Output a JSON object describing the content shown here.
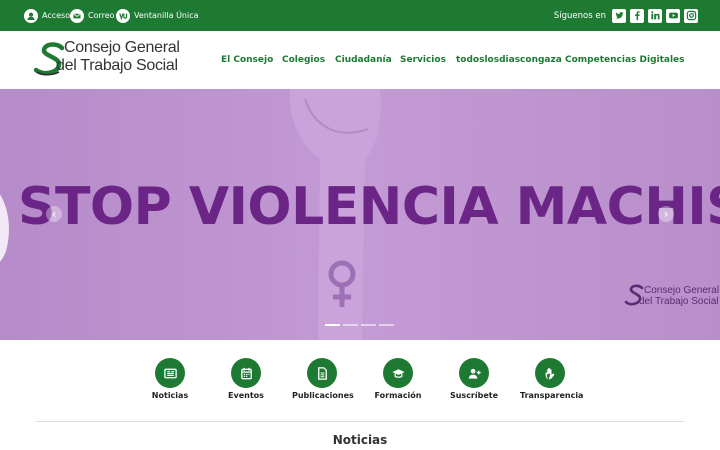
{
  "topbar": {
    "links": [
      {
        "label": "Acceso",
        "icon": "user-icon"
      },
      {
        "label": "Correo",
        "icon": "mail-icon"
      },
      {
        "label": "Ventanilla Única",
        "icon": "vu-icon"
      }
    ],
    "follow_label": "Síguenos en",
    "social": [
      "twitter-icon",
      "facebook-icon",
      "linkedin-icon",
      "youtube-icon",
      "instagram-icon"
    ]
  },
  "header": {
    "logo_line1": "Consejo General",
    "logo_line2": "del Trabajo Social",
    "nav": [
      "El Consejo",
      "Colegios",
      "Ciudadanía",
      "Servicios",
      "todoslosdiascongaza",
      "Competencias Digitales"
    ]
  },
  "hero": {
    "slogan": "STOP VIOLENCIA MACHISTA",
    "watermark_line1": "Consejo General",
    "watermark_line2": "del Trabajo Social",
    "slides": 4,
    "active_slide": 1
  },
  "quick_links": [
    {
      "label": "Noticias",
      "icon": "newspaper-icon"
    },
    {
      "label": "Eventos",
      "icon": "calendar-icon"
    },
    {
      "label": "Publicaciones",
      "icon": "document-icon"
    },
    {
      "label": "Formación",
      "icon": "graduation-cap-icon"
    },
    {
      "label": "Suscríbete",
      "icon": "user-plus-icon"
    },
    {
      "label": "Transparencia",
      "icon": "hand-icon"
    }
  ],
  "section": {
    "title": "Noticias"
  },
  "colors": {
    "brand_green": "#1e7a33",
    "hero_purple": "#c39ad4",
    "slogan_purple": "#6b2586"
  }
}
